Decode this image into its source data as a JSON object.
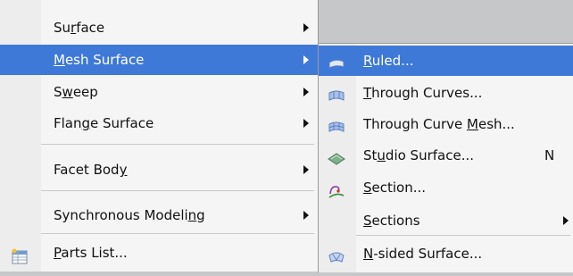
{
  "main_menu": {
    "items": [
      {
        "pre": "Su",
        "key": "r",
        "post": "face",
        "submenu": true
      },
      {
        "pre": "",
        "key": "M",
        "post": "esh Surface",
        "submenu": true,
        "highlighted": true
      },
      {
        "pre": "S",
        "key": "w",
        "post": "eep",
        "submenu": true
      },
      {
        "pre": "Flan",
        "key": "g",
        "post": "e Surface",
        "submenu": true
      },
      {
        "pre": "Facet Bod",
        "key": "y",
        "post": "",
        "submenu": true
      },
      {
        "pre": "Synchronous Modeli",
        "key": "n",
        "post": "g",
        "submenu": true
      },
      {
        "pre": "",
        "key": "P",
        "post": "arts List...",
        "submenu": false,
        "icon": "parts-list-icon"
      }
    ]
  },
  "sub_menu": {
    "items": [
      {
        "pre": "",
        "key": "R",
        "post": "uled...",
        "icon": "ruled-surface-icon",
        "highlighted": true
      },
      {
        "pre": "",
        "key": "T",
        "post": "hrough Curves...",
        "icon": "through-curves-icon"
      },
      {
        "pre": "Through Curve ",
        "key": "M",
        "post": "esh...",
        "icon": "through-curve-mesh-icon"
      },
      {
        "pre": "St",
        "key": "u",
        "post": "dio Surface...",
        "icon": "studio-surface-icon",
        "shortcut": "N"
      },
      {
        "pre": "",
        "key": "S",
        "post": "ection...",
        "icon": "section-icon"
      },
      {
        "pre": "",
        "key": "S",
        "post": "ections",
        "submenu": true
      },
      {
        "pre": "",
        "key": "N",
        "post": "-sided Surface...",
        "icon": "n-sided-surface-icon"
      }
    ]
  },
  "colors": {
    "highlight": "#3f79d7",
    "menu_background": "#f5f5f5",
    "backdrop": "#c6c7c9"
  }
}
